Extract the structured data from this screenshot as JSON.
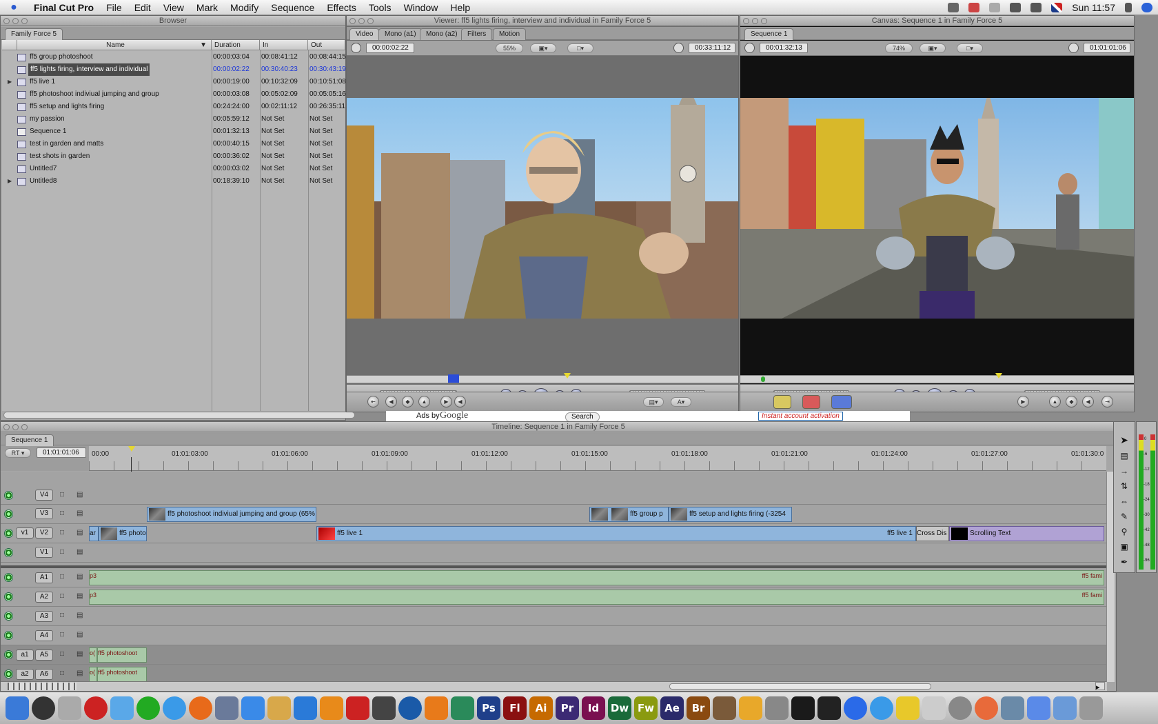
{
  "menubar": {
    "apple": "",
    "app_name": "Final Cut Pro",
    "items": [
      "File",
      "Edit",
      "View",
      "Mark",
      "Modify",
      "Sequence",
      "Effects",
      "Tools",
      "Window",
      "Help"
    ],
    "clock": "Sun 11:57"
  },
  "browser": {
    "title": "Browser",
    "tab": "Family Force 5",
    "columns": [
      "Name",
      "Duration",
      "In",
      "Out"
    ],
    "rows": [
      {
        "name": "ff5 group photoshoot",
        "duration": "00:00:03:04",
        "in": "00:08:41:12",
        "out": "00:08:44:15"
      },
      {
        "name": "ff5 lights firing, interview and individual",
        "duration": "00:00:02:22",
        "in": "00:30:40:23",
        "out": "00:30:43:19"
      },
      {
        "name": "ff5 live 1",
        "duration": "00:00:19:00",
        "in": "00:10:32:09",
        "out": "00:10:51:08"
      },
      {
        "name": "ff5 photoshoot indiviual jumping and group",
        "duration": "00:00:03:08",
        "in": "00:05:02:09",
        "out": "00:05:05:16"
      },
      {
        "name": "ff5 setup and lights firing",
        "duration": "00:24:24:00",
        "in": "00:02:11:12",
        "out": "00:26:35:11"
      },
      {
        "name": "my passion",
        "duration": "00:05:59:12",
        "in": "Not Set",
        "out": "Not Set"
      },
      {
        "name": "Sequence 1",
        "duration": "00:01:32:13",
        "in": "Not Set",
        "out": "Not Set"
      },
      {
        "name": "test in garden and matts",
        "duration": "00:00:40:15",
        "in": "Not Set",
        "out": "Not Set"
      },
      {
        "name": "test shots in garden",
        "duration": "00:00:36:02",
        "in": "Not Set",
        "out": "Not Set"
      },
      {
        "name": "Untitled7",
        "duration": "00:00:03:02",
        "in": "Not Set",
        "out": "Not Set"
      },
      {
        "name": "Untitled8",
        "duration": "00:18:39:10",
        "in": "Not Set",
        "out": "Not Set"
      }
    ]
  },
  "viewer": {
    "title": "Viewer: ff5 lights firing, interview and individual in Family Force 5",
    "tabs": [
      "Video",
      "Mono (a1)",
      "Mono (a2)",
      "Filters",
      "Motion"
    ],
    "duration_tc": "00:00:02:22",
    "zoom": "55%",
    "current_tc": "00:33:11:12"
  },
  "canvas": {
    "title": "Canvas: Sequence 1 in Family Force 5",
    "tab": "Sequence 1",
    "duration_tc": "00:01:32:13",
    "zoom": "74%",
    "current_tc": "01:01:01:06"
  },
  "ad_strip": {
    "ads_by": "Ads by",
    "google": "Google",
    "search": "Search",
    "promo": "Instant account activation"
  },
  "timeline": {
    "title": "Timeline: Sequence 1 in Family Force 5",
    "tab": "Sequence 1",
    "rt": "RT",
    "current_tc": "01:01:01:06",
    "ruler": [
      "00:00",
      "01:01:03:00",
      "01:01:06:00",
      "01:01:09:00",
      "01:01:12:00",
      "01:01:15:00",
      "01:01:18:00",
      "01:01:21:00",
      "01:01:24:00",
      "01:01:27:00",
      "01:01:30:0"
    ],
    "video_tracks": [
      "V4",
      "V3",
      "V2",
      "V1"
    ],
    "audio_tracks": [
      "A1",
      "A2",
      "A3",
      "A4",
      "A5",
      "A6"
    ],
    "src_v": "v1",
    "src_a1": "a1",
    "src_a2": "a2",
    "clips": {
      "v3_a": "ff5 photoshoot indiviual jumping and group (65%",
      "v3_b": "ff5 group p",
      "v3_c": "ff5 setup and lights firing (-3254",
      "v2_a": "ar",
      "v2_b": "ff5 photo",
      "v2_c": "ff5 live 1",
      "v2_d": "ff5 live 1",
      "v2_e": "Cross Dis",
      "v2_f": "Scrolling Text",
      "a1_start": "p3",
      "a1_end": "ff5 fami",
      "a2_start": "p3",
      "a2_end": "ff5 fami",
      "a5": "ff5 photoshoot",
      "a6": "ff5 photoshoot",
      "a5_pre": "o(",
      "a6_pre": "o("
    },
    "meter_scale": [
      "0",
      "-6",
      "-12",
      "-18",
      "-24",
      "-30",
      "-42",
      "-48",
      "-96"
    ]
  },
  "dock": {
    "labels": [
      "Ps",
      "Fl",
      "Ai",
      "Pr",
      "Id",
      "Dw",
      "Fw",
      "Ae",
      "Br"
    ],
    "colors": {
      "ps": "#1f3f8a",
      "fl": "#8a1010",
      "ai": "#c66a00",
      "pr": "#3c2a74",
      "id": "#7a1050",
      "dw": "#1a6a3a",
      "fw": "#8a9a10",
      "ae": "#2a2a6a",
      "br": "#8a4a10"
    }
  }
}
